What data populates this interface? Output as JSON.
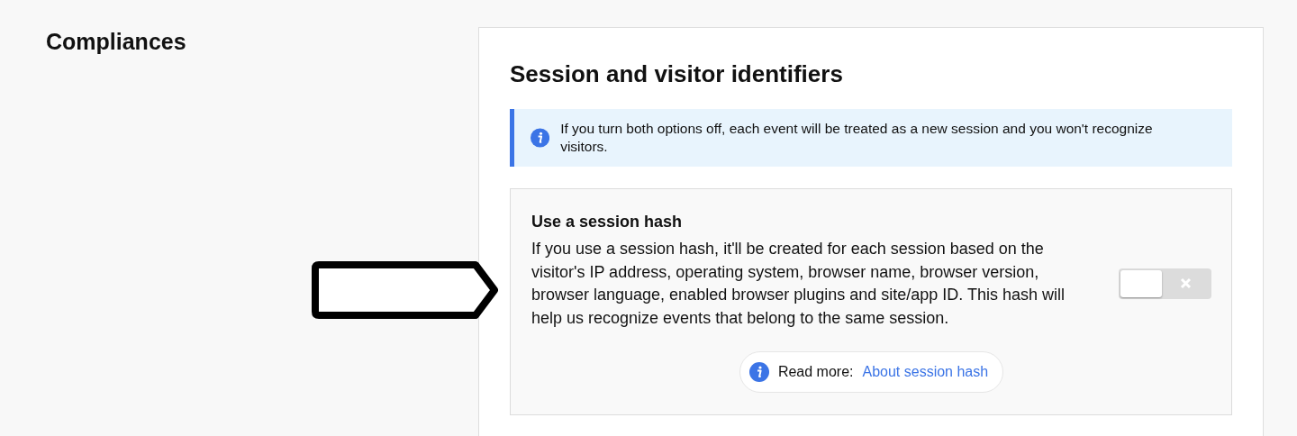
{
  "section_title": "Compliances",
  "card": {
    "title": "Session and visitor identifiers",
    "notice": "If you turn both options off, each event will be treated as a new session and you won't recognize visitors.",
    "options": [
      {
        "title": "Use a session hash",
        "description": "If you use a session hash, it'll be created for each session based on the visitor's IP address, operating system, browser name, browser version, browser language, enabled browser plugins and site/app ID. This hash will help us recognize events that belong to the same session.",
        "on": false,
        "read_more_label": "Read more:",
        "read_more_link": "About session hash"
      }
    ]
  }
}
